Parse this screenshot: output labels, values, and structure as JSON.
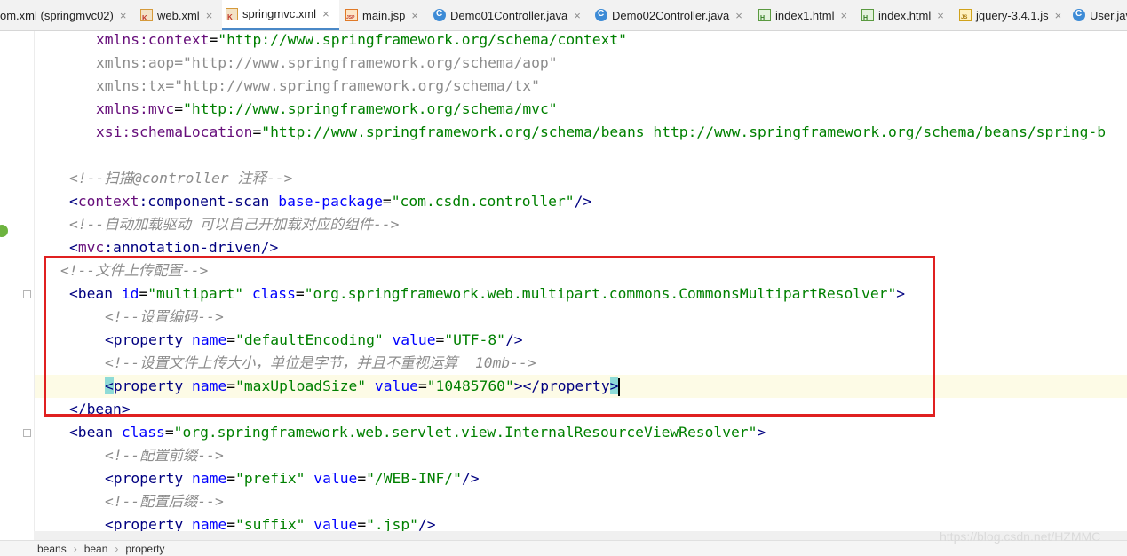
{
  "tabs": [
    {
      "label": "om.xml (springmvc02)",
      "icon": "xml-file-icon",
      "active": false
    },
    {
      "label": "web.xml",
      "icon": "xml-file-icon",
      "active": false
    },
    {
      "label": "springmvc.xml",
      "icon": "xml-file-icon",
      "active": true
    },
    {
      "label": "main.jsp",
      "icon": "jsp-file-icon",
      "active": false
    },
    {
      "label": "Demo01Controller.java",
      "icon": "java-class-icon",
      "active": false
    },
    {
      "label": "Demo02Controller.java",
      "icon": "java-class-icon",
      "active": false
    },
    {
      "label": "index1.html",
      "icon": "html-file-icon",
      "active": false
    },
    {
      "label": "index.html",
      "icon": "html-file-icon",
      "active": false
    },
    {
      "label": "jquery-3.4.1.js",
      "icon": "js-file-icon",
      "active": false
    },
    {
      "label": "User.jav",
      "icon": "java-class-icon",
      "active": false
    }
  ],
  "close_glyph": "×",
  "code": {
    "l1": {
      "ns": "xmlns",
      "colon": ":",
      "name": "context",
      "eq": "=",
      "val": "\"http://www.springframework.org/schema/context\""
    },
    "l2": {
      "text": "xmlns:aop=\"http://www.springframework.org/schema/aop\""
    },
    "l3": {
      "text": "xmlns:tx=\"http://www.springframework.org/schema/tx\""
    },
    "l4": {
      "ns": "xmlns",
      "colon": ":",
      "name": "mvc",
      "eq": "=",
      "val": "\"http://www.springframework.org/schema/mvc\""
    },
    "l5": {
      "ns": "xsi",
      "colon": ":",
      "name": "schemaLocation",
      "eq": "=",
      "val": "\"http://www.springframework.org/schema/beans http://www.springframework.org/schema/beans/spring-b"
    },
    "l6": {
      "comment": "<!--扫描@controller 注释-->"
    },
    "l7": {
      "open": "<",
      "ns": "context",
      "colon": ":",
      "tag": "component-scan",
      "attr": " base-package",
      "eq": "=",
      "val": "\"com.csdn.controller\"",
      "close": "/>"
    },
    "l8": {
      "comment": "<!--自动加载驱动 可以自己开加载对应的组件-->"
    },
    "l9": {
      "open": "<",
      "ns": "mvc",
      "colon": ":",
      "tag": "annotation-driven",
      "close": "/>"
    },
    "l10": {
      "comment": "<!--文件上传配置-->"
    },
    "l11": {
      "open": "<bean",
      "attr1": " id",
      "eq": "=",
      "val1": "\"multipart\"",
      "attr2": " class",
      "val2": "\"org.springframework.web.multipart.commons.CommonsMultipartResolver\"",
      "close": ">"
    },
    "l12": {
      "comment": "<!--设置编码-->"
    },
    "l13": {
      "open": "<property",
      "attr1": " name",
      "eq": "=",
      "val1": "\"defaultEncoding\"",
      "attr2": " value",
      "val2": "\"UTF-8\"",
      "close": "/>"
    },
    "l14": {
      "comment": "<!--设置文件上传大小，单位是字节，并且不重视运算  10mb-->"
    },
    "l15": {
      "lt": "<",
      "open": "property",
      "attr1": " name",
      "eq": "=",
      "val1": "\"maxUploadSize\"",
      "attr2": " value",
      "val2": "\"10485760\"",
      "mid": "></",
      "ctag": "property",
      "gt": ">"
    },
    "l16": {
      "text": "</bean>"
    },
    "l17": {
      "open": "<bean",
      "attr": " class",
      "eq": "=",
      "val": "\"org.springframework.web.servlet.view.InternalResourceViewResolver\"",
      "close": ">"
    },
    "l18": {
      "comment": "<!--配置前缀-->"
    },
    "l19": {
      "open": "<property",
      "attr1": " name",
      "eq": "=",
      "val1": "\"prefix\"",
      "attr2": " value",
      "val2": "\"/WEB-INF/\"",
      "close": "/>"
    },
    "l20": {
      "comment": "<!--配置后缀-->"
    },
    "l21": {
      "open": "<property",
      "attr1": " name",
      "eq": "=",
      "val1": "\"suffix\"",
      "attr2": " value",
      "val2": "\".jsp\"",
      "close": "/>"
    }
  },
  "breadcrumb": [
    "beans",
    "bean",
    "property"
  ],
  "breadcrumb_sep": "›",
  "watermark": "https://blog.csdn.net/HZMMC",
  "colors": {
    "highlight_box": "#e02020",
    "tab_active_underline": "#4a88c7",
    "current_line": "#fdfbe6",
    "tag_match": "#8edbd7"
  }
}
